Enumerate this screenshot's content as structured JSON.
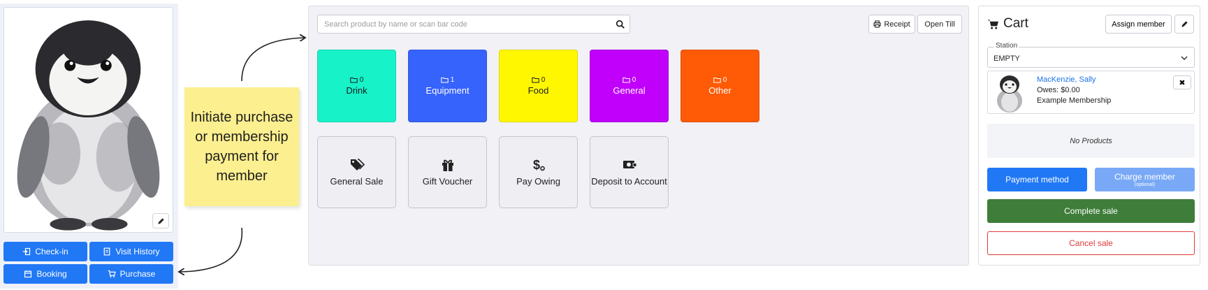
{
  "profile": {
    "buttons": {
      "checkin": "Check-in",
      "visit_history": "Visit History",
      "booking": "Booking",
      "purchase": "Purchase"
    }
  },
  "annotation": {
    "text": "Initiate purchase or membership payment for member"
  },
  "pos": {
    "search_placeholder": "Search product by name or scan bar code",
    "receipt_label": "Receipt",
    "open_till_label": "Open Till",
    "categories": [
      {
        "count": "0",
        "label": "Drink",
        "color": "#17f2c8",
        "text_color": "#1b1b1b"
      },
      {
        "count": "1",
        "label": "Equipment",
        "color": "#3663fb",
        "text_color": "#ffffff"
      },
      {
        "count": "0",
        "label": "Food",
        "color": "#fff700",
        "text_color": "#1b1b1b"
      },
      {
        "count": "0",
        "label": "General",
        "color": "#c000fb",
        "text_color": "#ffffff"
      },
      {
        "count": "0",
        "label": "Other",
        "color": "#ff5a05",
        "text_color": "#ffffff"
      }
    ],
    "actions": [
      {
        "label": "General Sale",
        "icon": "tags-icon"
      },
      {
        "label": "Gift Voucher",
        "icon": "gift-icon"
      },
      {
        "label": "Pay Owing",
        "icon": "dollar-icon"
      },
      {
        "label": "Deposit to Account",
        "icon": "wallet-icon"
      }
    ]
  },
  "cart": {
    "title": "Cart",
    "assign_member_label": "Assign member",
    "station_label": "Station",
    "station_value": "EMPTY",
    "member": {
      "name": "MacKenzie, Sally",
      "owes": "Owes: $0.00",
      "plan": "Example Membership"
    },
    "no_products": "No Products",
    "payment_method_label": "Payment method",
    "charge_member_label": "Charge member",
    "charge_member_sub": "(optional)",
    "complete_sale_label": "Complete sale",
    "cancel_sale_label": "Cancel sale"
  },
  "colors": {
    "primary": "#2178f5",
    "success": "#3e7e3a",
    "danger": "#e03a3a",
    "sticky": "#fcef8f"
  }
}
